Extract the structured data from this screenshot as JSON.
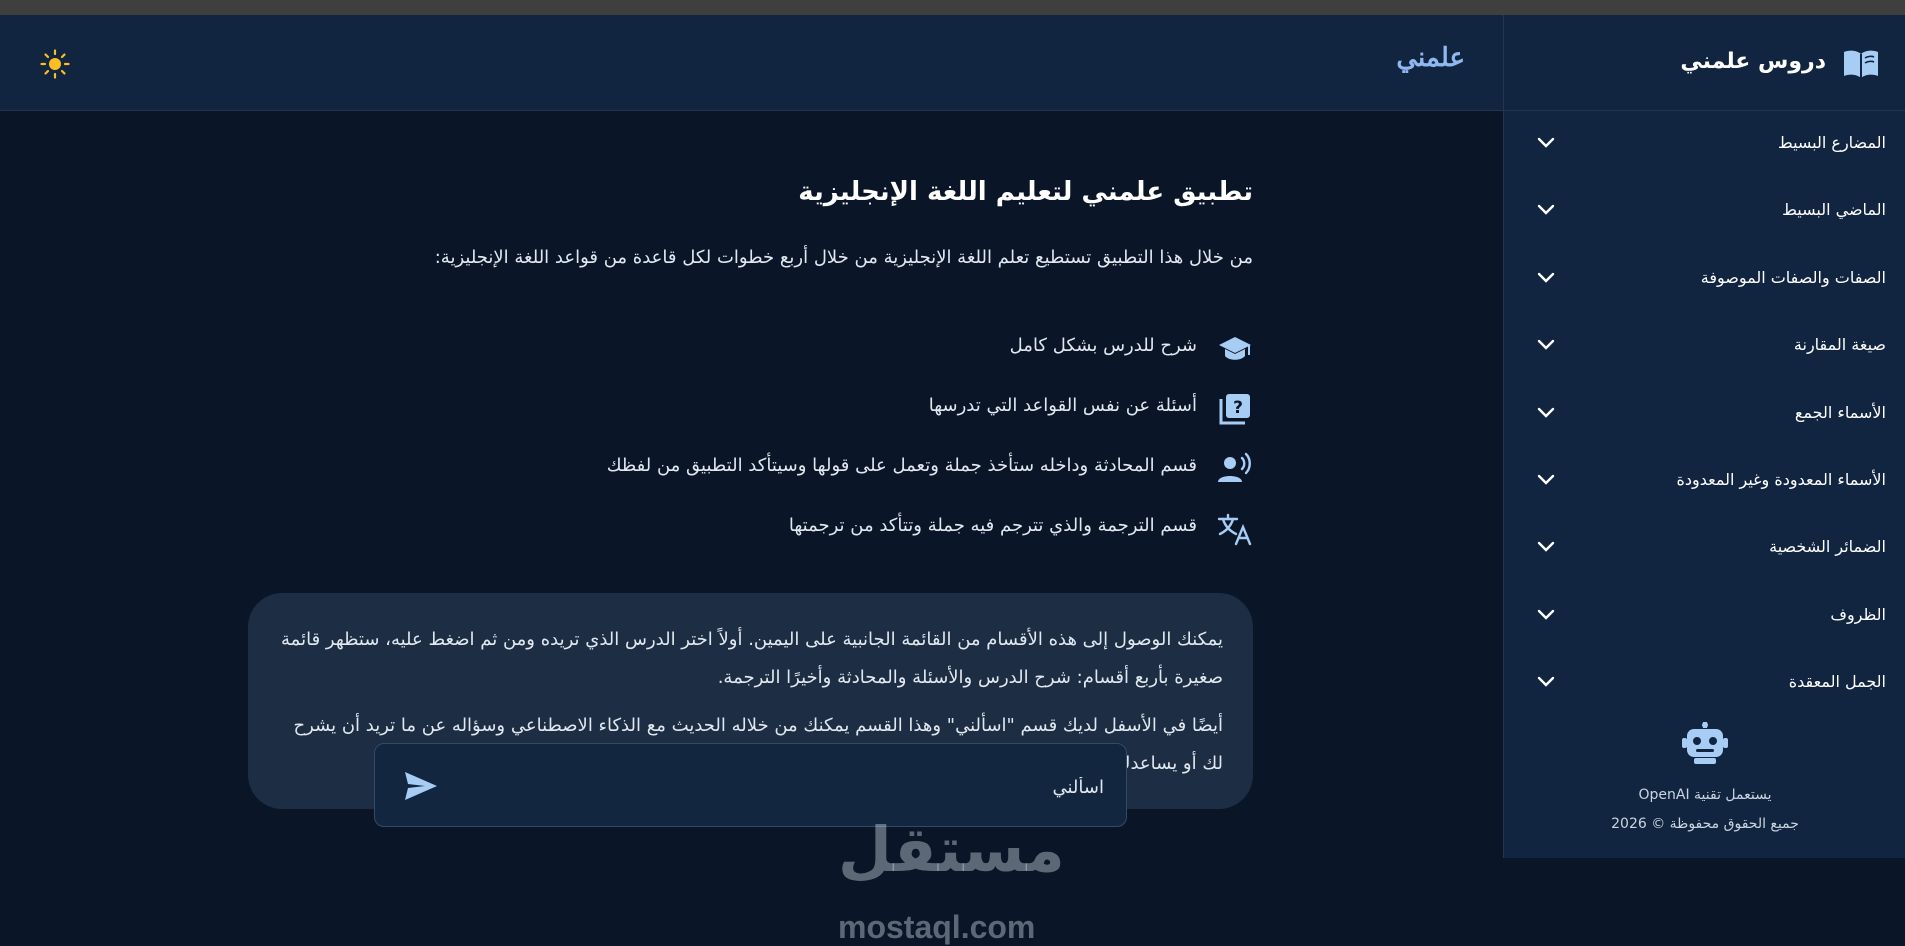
{
  "header": {
    "brand": "علمني",
    "theme_icon": "sun-icon"
  },
  "sidebar": {
    "title": "دروس علمني",
    "title_icon": "book-icon",
    "items": [
      {
        "label": "المضارع البسيط"
      },
      {
        "label": "الماضي البسيط"
      },
      {
        "label": "الصفات والصفات الموصوفة"
      },
      {
        "label": "صيغة المقارنة"
      },
      {
        "label": "الأسماء الجمع"
      },
      {
        "label": "الأسماء المعدودة وغير المعدودة"
      },
      {
        "label": "الضمائر الشخصية"
      },
      {
        "label": "الظروف"
      },
      {
        "label": "الجمل المعقدة"
      }
    ],
    "footer": {
      "robot_icon": "robot-icon",
      "powered_by": "يستعمل تقنية OpenAI",
      "copyright": "جميع الحقوق محفوظة © 2026"
    }
  },
  "main": {
    "title": "تطبيق علمني لتعليم اللغة الإنجليزية",
    "intro": "من خلال هذا التطبيق تستطيع تعلم اللغة الإنجليزية من خلال أربع خطوات لكل قاعدة من قواعد اللغة الإنجليزية:",
    "features": [
      {
        "icon": "graduation-cap-icon",
        "text": "شرح للدرس بشكل كامل"
      },
      {
        "icon": "quiz-icon",
        "text": "أسئلة عن نفس القواعد التي تدرسها"
      },
      {
        "icon": "voice-icon",
        "text": "قسم المحادثة وداخله ستأخذ جملة وتعمل على قولها وسيتأكد التطبيق من لفظك"
      },
      {
        "icon": "translate-icon",
        "text": "قسم الترجمة والذي تترجم فيه جملة وتتأكد من ترجمتها"
      }
    ],
    "info": {
      "p1": "يمكنك الوصول إلى هذه الأقسام من القائمة الجانبية على اليمين. أولاً اختر الدرس الذي تريده ومن ثم اضغط عليه، ستظهر قائمة صغيرة بأربع أقسام: شرح الدرس والأسئلة والمحادثة وأخيرًا الترجمة.",
      "p2": "أيضًا في الأسفل لديك قسم \"اسألني\" وهذا القسم يمكنك من خلاله الحديث مع الذكاء الاصطناعي وسؤاله عن ما تريد أن يشرح لك أو يساعدك"
    },
    "ask": {
      "placeholder": "اسألني",
      "send_icon": "send-icon"
    }
  },
  "watermark": {
    "ar": "مستقل",
    "en": "mostaql.com"
  },
  "colors": {
    "accent": "#8fb7f0",
    "icon": "#a8cdf5",
    "sun": "#fbbf24",
    "panel": "#112540",
    "background": "#0a1628"
  }
}
